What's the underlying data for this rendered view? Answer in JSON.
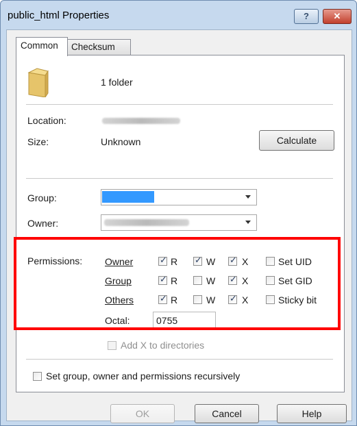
{
  "window": {
    "title": "public_html Properties",
    "help_label": "?",
    "close_label": "✕"
  },
  "tabs": [
    {
      "label": "Common"
    },
    {
      "label": "Checksum"
    }
  ],
  "summary": {
    "icon": "folder-icon",
    "text": "1 folder"
  },
  "info": {
    "location_label": "Location:",
    "size_label": "Size:",
    "size_value": "Unknown",
    "calculate_label": "Calculate"
  },
  "ownership": {
    "group_label": "Group:",
    "owner_label": "Owner:"
  },
  "permissions": {
    "label": "Permissions:",
    "rows": [
      {
        "name": "Owner",
        "r": true,
        "w": true,
        "x": true,
        "extra_label": "Set UID",
        "extra": false
      },
      {
        "name": "Group",
        "r": true,
        "w": false,
        "x": true,
        "extra_label": "Set GID",
        "extra": false
      },
      {
        "name": "Others",
        "r": true,
        "w": false,
        "x": true,
        "extra_label": "Sticky bit",
        "extra": false
      }
    ],
    "r_label": "R",
    "w_label": "W",
    "x_label": "X",
    "octal_label": "Octal:",
    "octal_value": "0755",
    "add_x_label": "Add X to directories"
  },
  "recursive_label": "Set group, owner and permissions recursively",
  "buttons": {
    "ok": "OK",
    "cancel": "Cancel",
    "help": "Help"
  },
  "colors": {
    "highlight": "#ff0000",
    "selection": "#3399ff"
  }
}
